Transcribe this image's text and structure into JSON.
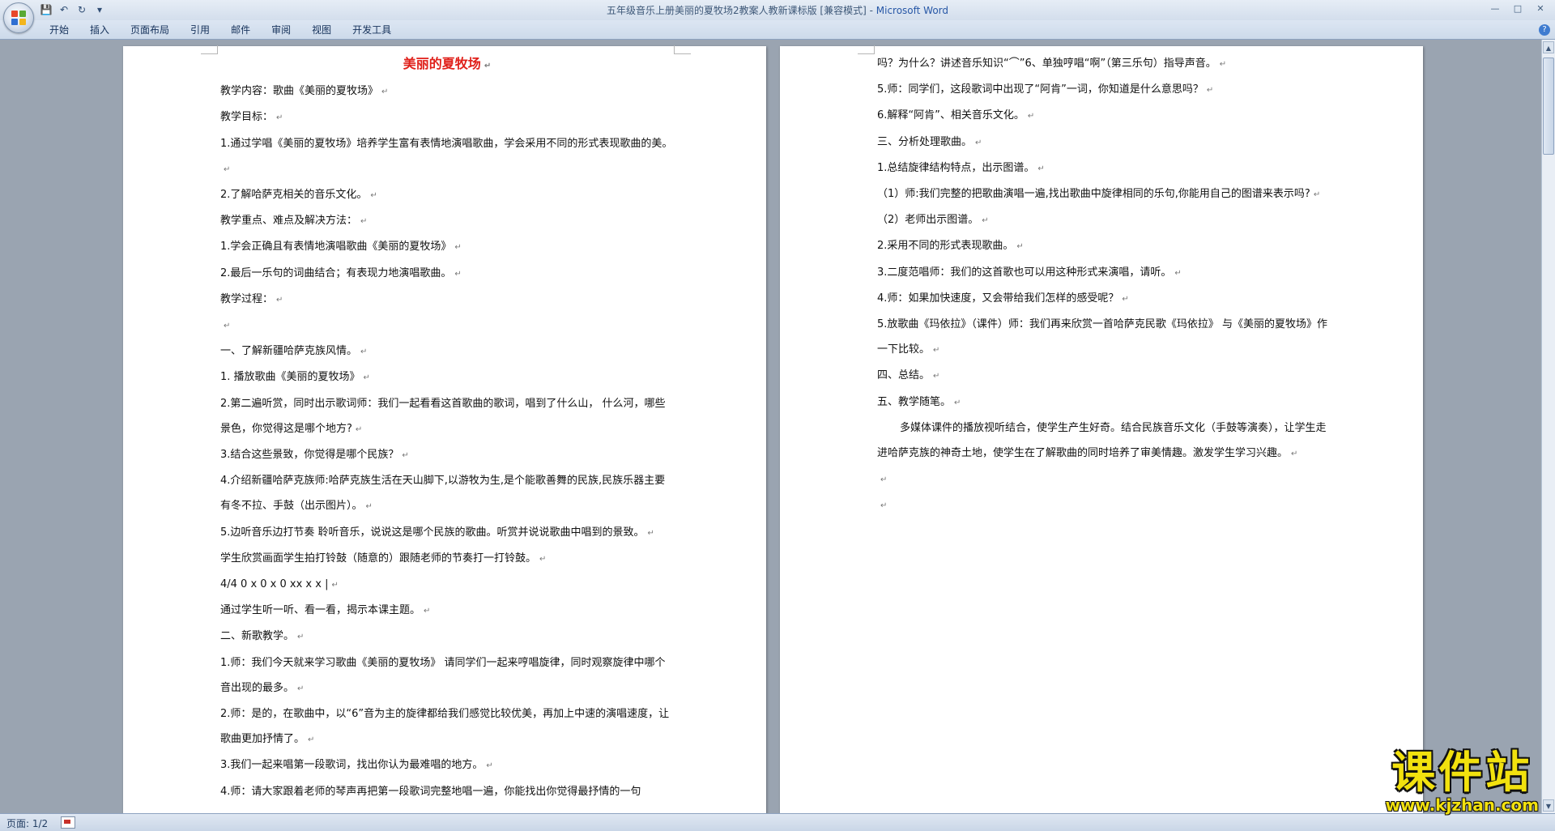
{
  "window": {
    "title": "五年级音乐上册美丽的夏牧场2教案人教新课标版 [兼容模式] - ",
    "app_name": "Microsoft Word"
  },
  "ribbon": {
    "tabs": [
      "开始",
      "插入",
      "页面布局",
      "引用",
      "邮件",
      "审阅",
      "视图",
      "开发工具"
    ]
  },
  "document": {
    "page1": [
      "美丽的夏牧场",
      "教学内容：歌曲《美丽的夏牧场》",
      "教学目标：",
      "1.通过学唱《美丽的夏牧场》培养学生富有表情地演唱歌曲，学会采用不同的形式表现歌曲的美。",
      "2.了解哈萨克相关的音乐文化。",
      "教学重点、难点及解决方法：",
      "1.学会正确且有表情地演唱歌曲《美丽的夏牧场》",
      "2.最后一乐句的词曲结合；有表现力地演唱歌曲。",
      "教学过程：",
      "",
      "一、了解新疆哈萨克族风情。",
      "1. 播放歌曲《美丽的夏牧场》",
      "2.第二遍听赏，同时出示歌词师：我们一起看看这首歌曲的歌词，唱到了什么山， 什么河，哪些景色，你觉得这是哪个地方?",
      "3.结合这些景致，你觉得是哪个民族？",
      "4.介绍新疆哈萨克族师:哈萨克族生活在天山脚下,以游牧为生,是个能歌善舞的民族,民族乐器主要有冬不拉、手鼓（出示图片）。",
      "5.边听音乐边打节奏 聆听音乐，说说这是哪个民族的歌曲。听赏并说说歌曲中唱到的景致。",
      "学生欣赏画面学生拍打铃鼓（随意的）跟随老师的节奏打一打铃鼓。",
      "4/4 0 x 0 x 0 xx x x |",
      "通过学生听一听、看一看，揭示本课主题。",
      "二、新歌教学。",
      "1.师：我们今天就来学习歌曲《美丽的夏牧场》 请同学们一起来哼唱旋律，同时观察旋律中哪个音出现的最多。",
      "2.师：是的，在歌曲中，以“6”音为主的旋律都给我们感觉比较优美，再加上中速的演唱速度，让歌曲更加抒情了。",
      "3.我们一起来唱第一段歌词，找出你认为最难唱的地方。",
      "4.师：请大家跟着老师的琴声再把第一段歌词完整地唱一遍，你能找出你觉得最抒情的一句"
    ],
    "page2": [
      "吗？为什么？讲述音乐知识“⌒”6、单独哼唱“啊”（第三乐句）指导声音。",
      "5.师：同学们，这段歌词中出现了“阿肯”一词，你知道是什么意思吗？",
      "6.解释“阿肯”、相关音乐文化。",
      "三、分析处理歌曲。",
      "1.总结旋律结构特点，出示图谱。",
      "（1）师:我们完整的把歌曲演唱一遍,找出歌曲中旋律相同的乐句,你能用自己的图谱来表示吗?",
      "（2）老师出示图谱。",
      "2.采用不同的形式表现歌曲。",
      "3.二度范唱师：我们的这首歌也可以用这种形式来演唱，请听。",
      "4.师：如果加快速度，又会带给我们怎样的感受呢？",
      "5.放歌曲《玛依拉》（课件）师：我们再来欣赏一首哈萨克民歌《玛依拉》 与《美丽的夏牧场》作一下比较。",
      "四、总结。",
      "五、教学随笔。",
      "多媒体课件的播放视听结合，使学生产生好奇。结合民族音乐文化（手鼓等演奏），让学生走进哈萨克族的神奇土地，使学生在了解歌曲的同时培养了审美情趣。激发学生学习兴趣。",
      "",
      ""
    ]
  },
  "status": {
    "page_label": "页面: 1/2"
  },
  "watermark": {
    "title": "课件站",
    "url": "www.kjzhan.com"
  },
  "colors": {
    "title_red": "#e0201a",
    "ribbon_blue": "#dce6f3",
    "workspace": "#9aa4b1",
    "watermark_yellow": "#f2e10e"
  },
  "icons": [
    "office-button-icon",
    "save-icon",
    "undo-icon",
    "redo-icon",
    "customize-qat-icon",
    "minimize-icon",
    "maximize-icon",
    "close-icon",
    "help-icon",
    "proofing-icon"
  ]
}
